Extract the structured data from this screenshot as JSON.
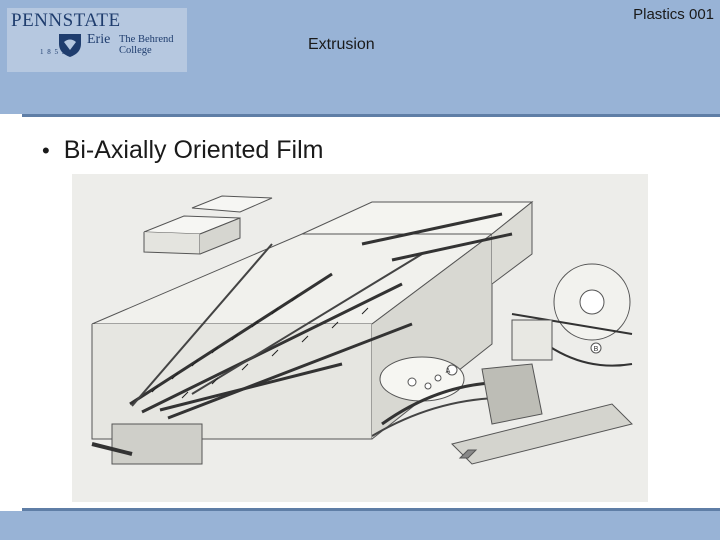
{
  "header": {
    "logo": {
      "institution": "PENNSTATE",
      "campus": "Erie",
      "year": "1 8 5 5",
      "college_line1": "The Behrend",
      "college_line2": "College"
    },
    "course_label": "Plastics 001",
    "topic_label": "Extrusion"
  },
  "colors": {
    "header_bg": "#98b3d6",
    "rule": "#5f7ea6",
    "logo_text": "#1f3d6e"
  },
  "content": {
    "bullet": "Bi-Axially Oriented Film",
    "figure_callouts": [
      "A",
      "B"
    ]
  }
}
